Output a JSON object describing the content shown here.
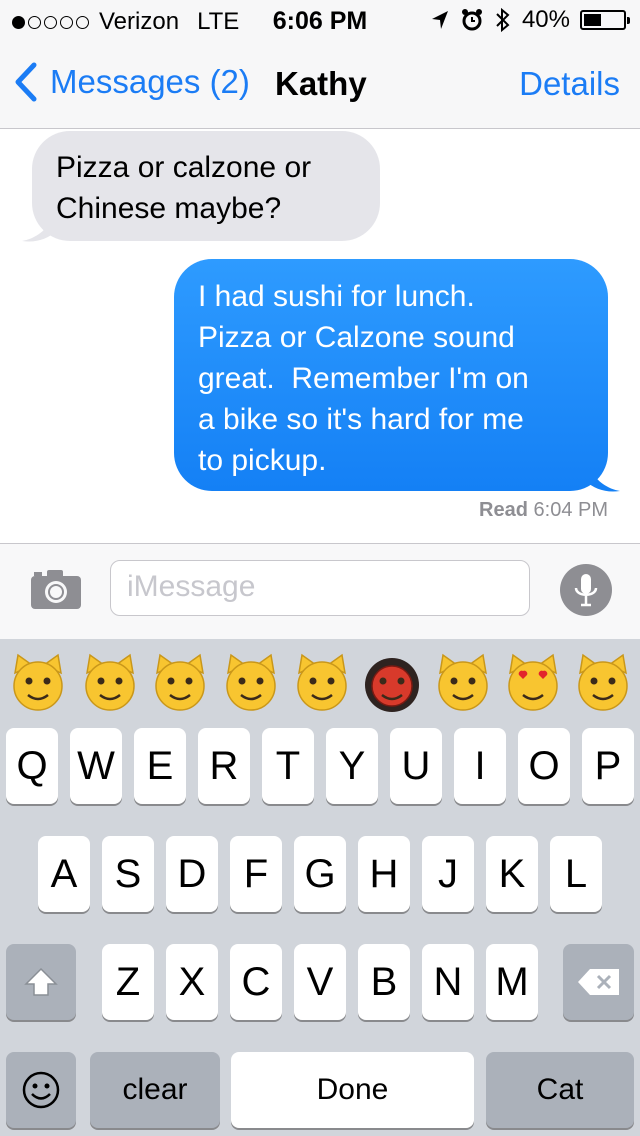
{
  "status": {
    "carrier": "Verizon",
    "network": "LTE",
    "time": "6:06 PM",
    "battery": "40%",
    "battery_level": 0.4,
    "signal_bars_filled": 1,
    "signal_bars_total": 5
  },
  "nav": {
    "back_label": "Messages (2)",
    "title": "Kathy",
    "details_label": "Details"
  },
  "messages": [
    {
      "direction": "incoming",
      "lines": [
        "Pizza or calzone or",
        "Chinese maybe?"
      ]
    },
    {
      "direction": "outgoing",
      "lines": [
        "I had sushi for lunch.",
        "Pizza or Calzone sound",
        "great.  Remember I'm on",
        "a bike so it's hard for me",
        "to pickup."
      ]
    }
  ],
  "receipt": {
    "label": "Read",
    "time": "6:04 PM"
  },
  "input": {
    "placeholder": "iMessage"
  },
  "keyboard": {
    "emoji_suggestions": [
      "smirking-cat",
      "weary-cat",
      "crying-cat",
      "cat-tears-of-joy",
      "pouting-cat",
      "ogre-mask",
      "grinning-cat",
      "heart-eyes-cat",
      "kissing-cat"
    ],
    "row1": [
      "Q",
      "W",
      "E",
      "R",
      "T",
      "Y",
      "U",
      "I",
      "O",
      "P"
    ],
    "row2": [
      "A",
      "S",
      "D",
      "F",
      "G",
      "H",
      "J",
      "K",
      "L"
    ],
    "row3": [
      "Z",
      "X",
      "C",
      "V",
      "B",
      "N",
      "M"
    ],
    "bottom": {
      "clear": "clear",
      "done": "Done",
      "cat": "Cat"
    }
  },
  "colors": {
    "accent": "#1b7cf5",
    "outgoing_bubble": "#1480f5",
    "incoming_bubble": "#e5e5ea",
    "keyboard_bg": "#d1d5db"
  }
}
